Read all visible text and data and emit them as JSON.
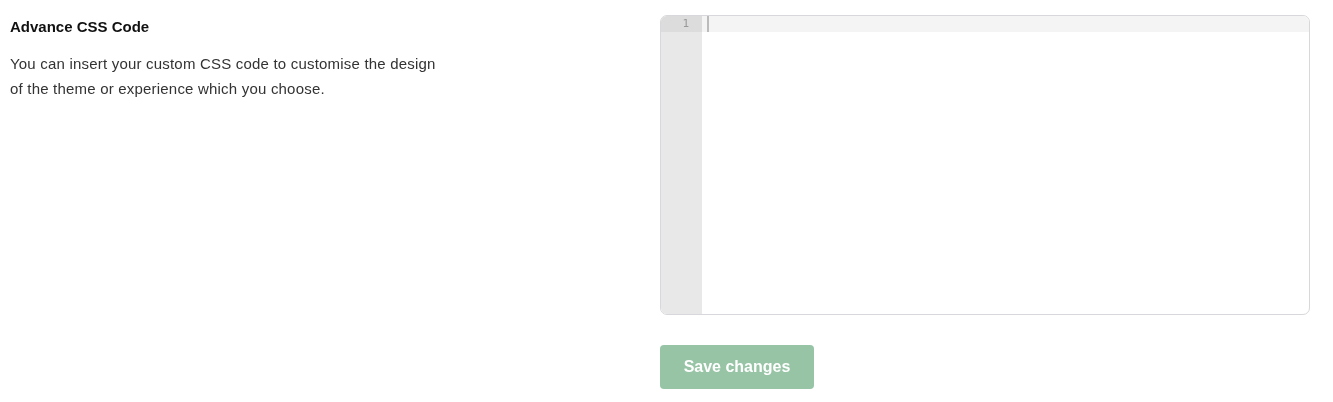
{
  "section": {
    "title": "Advance CSS Code",
    "description": "You can insert your custom CSS code to customise the design of the theme or experience which you choose."
  },
  "editor": {
    "lines": [
      {
        "number": "1",
        "active": true
      }
    ]
  },
  "save_button": {
    "label": "Save changes",
    "disabled": true
  }
}
